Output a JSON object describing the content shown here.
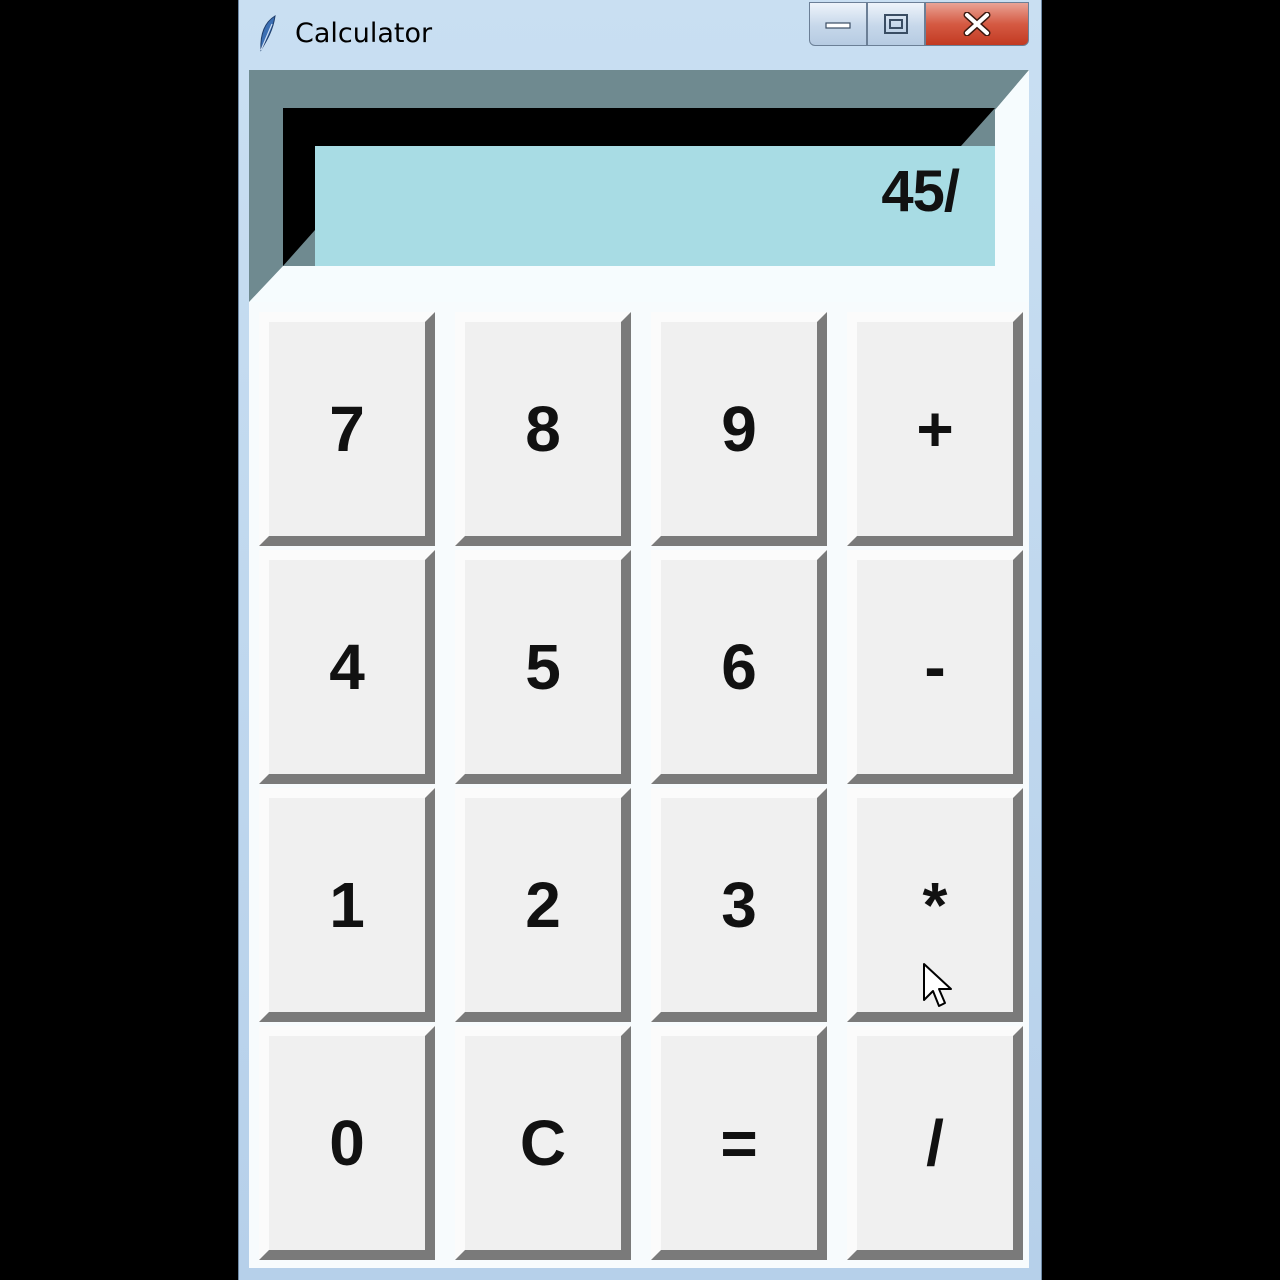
{
  "window": {
    "title": "Calculator",
    "icon": "feather-icon",
    "controls": [
      "minimize-icon",
      "maximize-icon",
      "close-icon"
    ]
  },
  "display": {
    "value": "45/"
  },
  "keypad": {
    "rows": [
      [
        "7",
        "8",
        "9",
        "+"
      ],
      [
        "4",
        "5",
        "6",
        "-"
      ],
      [
        "1",
        "2",
        "3",
        "*"
      ],
      [
        "0",
        "C",
        "=",
        "/"
      ]
    ]
  },
  "colors": {
    "display_background": "#a8dce4",
    "key_face": "#f0f0f0",
    "close_button": "#c9432b"
  }
}
